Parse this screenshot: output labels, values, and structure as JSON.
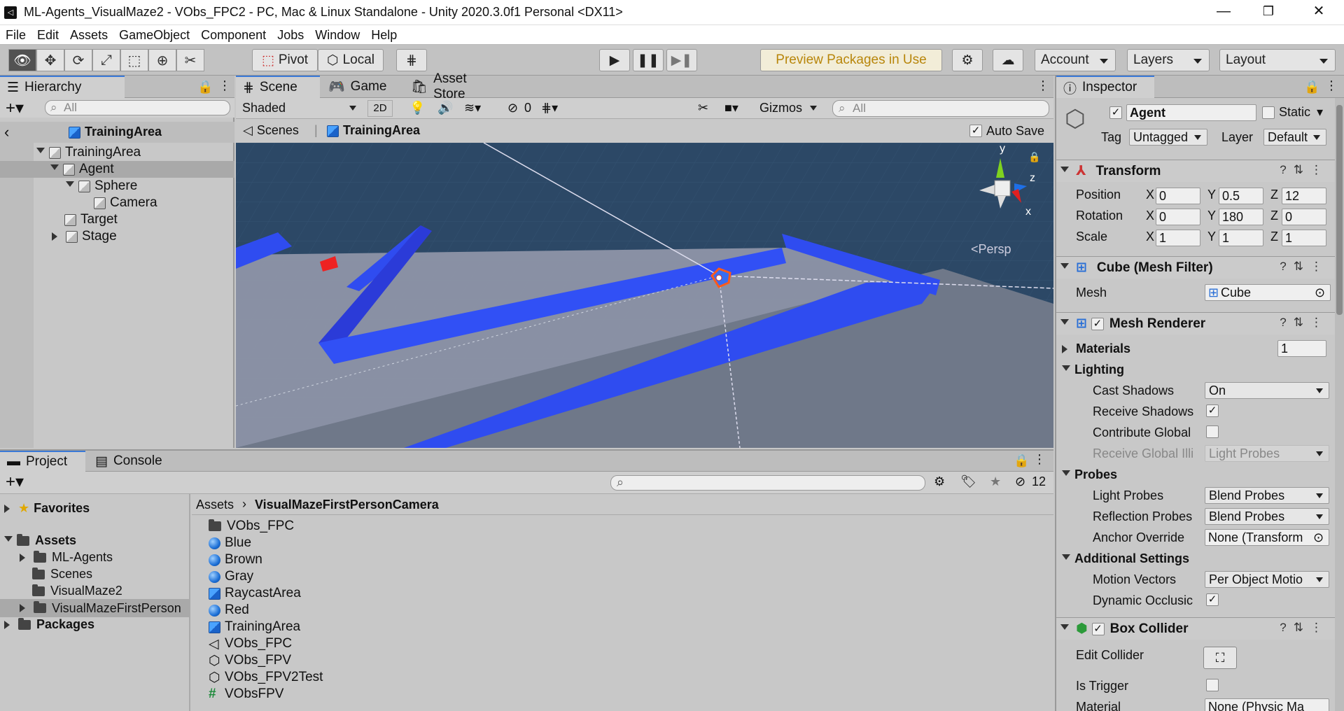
{
  "window": {
    "title": "ML-Agents_VisualMaze2 - VObs_FPC2 - PC, Mac & Linux Standalone - Unity 2020.3.0f1 Personal <DX11>",
    "minimize": "—",
    "restore": "❐",
    "close": "✕"
  },
  "menu": [
    "File",
    "Edit",
    "Assets",
    "GameObject",
    "Component",
    "Jobs",
    "Window",
    "Help"
  ],
  "toolbar": {
    "pivot": "Pivot",
    "local": "Local",
    "preview_packages": "Preview Packages in Use",
    "account": "Account",
    "layers": "Layers",
    "layout": "Layout"
  },
  "hierarchy": {
    "tab": "Hierarchy",
    "search_placeholder": "All",
    "scene": "TrainingArea",
    "items": [
      {
        "label": "TrainingArea"
      },
      {
        "label": "Agent"
      },
      {
        "label": "Sphere"
      },
      {
        "label": "Camera"
      },
      {
        "label": "Target"
      },
      {
        "label": "Stage"
      }
    ]
  },
  "scene_view": {
    "tabs": [
      "Scene",
      "Game",
      "Asset Store"
    ],
    "shading": "Shaded",
    "btn_2d": "2D",
    "hidden_count": "0",
    "gizmos": "Gizmos",
    "search_placeholder": "All",
    "breadcrumb_scenes": "Scenes",
    "breadcrumb_current": "TrainingArea",
    "auto_save": "Auto Save",
    "persp": "<Persp",
    "axis_y": "y",
    "axis_z": "z",
    "axis_x": "x"
  },
  "project": {
    "tabs": [
      "Project",
      "Console"
    ],
    "hidden_count": "12",
    "tree": [
      {
        "label": "Favorites"
      },
      {
        "label": "Assets"
      },
      {
        "label": "ML-Agents"
      },
      {
        "label": "Scenes"
      },
      {
        "label": "VisualMaze2"
      },
      {
        "label": "VisualMazeFirstPerson"
      },
      {
        "label": "Packages"
      }
    ],
    "breadcrumb_root": "Assets",
    "breadcrumb_current": "VisualMazeFirstPersonCamera",
    "files": [
      {
        "label": "VObs_FPC",
        "icon": "folder-icon"
      },
      {
        "label": "Blue",
        "icon": "material-icon"
      },
      {
        "label": "Brown",
        "icon": "material-icon"
      },
      {
        "label": "Gray",
        "icon": "material-icon"
      },
      {
        "label": "RaycastArea",
        "icon": "prefab-icon"
      },
      {
        "label": "Red",
        "icon": "material-icon"
      },
      {
        "label": "TrainingArea",
        "icon": "prefab-icon"
      },
      {
        "label": "VObs_FPC",
        "icon": "unity-scene-icon"
      },
      {
        "label": "VObs_FPV",
        "icon": "model-icon"
      },
      {
        "label": "VObs_FPV2Test",
        "icon": "model-icon"
      },
      {
        "label": "VObsFPV",
        "icon": "script-icon"
      }
    ]
  },
  "inspector": {
    "tab": "Inspector",
    "name": "Agent",
    "static_label": "Static",
    "tag_label": "Tag",
    "tag_value": "Untagged",
    "layer_label": "Layer",
    "layer_value": "Default",
    "transform": {
      "title": "Transform",
      "position_label": "Position",
      "position": {
        "x": "0",
        "y": "0.5",
        "z": "12"
      },
      "rotation_label": "Rotation",
      "rotation": {
        "x": "0",
        "y": "180",
        "z": "0"
      },
      "scale_label": "Scale",
      "scale": {
        "x": "1",
        "y": "1",
        "z": "1"
      }
    },
    "mesh_filter": {
      "title": "Cube (Mesh Filter)",
      "mesh_label": "Mesh",
      "mesh_value": "Cube"
    },
    "mesh_renderer": {
      "title": "Mesh Renderer",
      "materials_label": "Materials",
      "materials_count": "1",
      "lighting_label": "Lighting",
      "cast_shadows_label": "Cast Shadows",
      "cast_shadows_value": "On",
      "receive_shadows_label": "Receive Shadows",
      "contribute_gi_label": "Contribute Global",
      "receive_gi_label": "Receive Global Illi",
      "receive_gi_value": "Light Probes",
      "probes_label": "Probes",
      "light_probes_label": "Light Probes",
      "light_probes_value": "Blend Probes",
      "reflection_probes_label": "Reflection Probes",
      "reflection_probes_value": "Blend Probes",
      "anchor_override_label": "Anchor Override",
      "anchor_override_value": "None (Transform",
      "additional_label": "Additional Settings",
      "motion_vectors_label": "Motion Vectors",
      "motion_vectors_value": "Per Object Motio",
      "dynamic_occlusion_label": "Dynamic Occlusic"
    },
    "box_collider": {
      "title": "Box Collider",
      "edit_collider_label": "Edit Collider",
      "is_trigger_label": "Is Trigger",
      "material_label": "Material",
      "material_value": "None (Physic Ma"
    }
  },
  "colors": {
    "accent": "#3a79d7",
    "maze_blue": "#2f4cf0",
    "scene_bg": "#2d4a68",
    "floor": "#8e95a8",
    "preview_yellow": "#b8860b"
  }
}
